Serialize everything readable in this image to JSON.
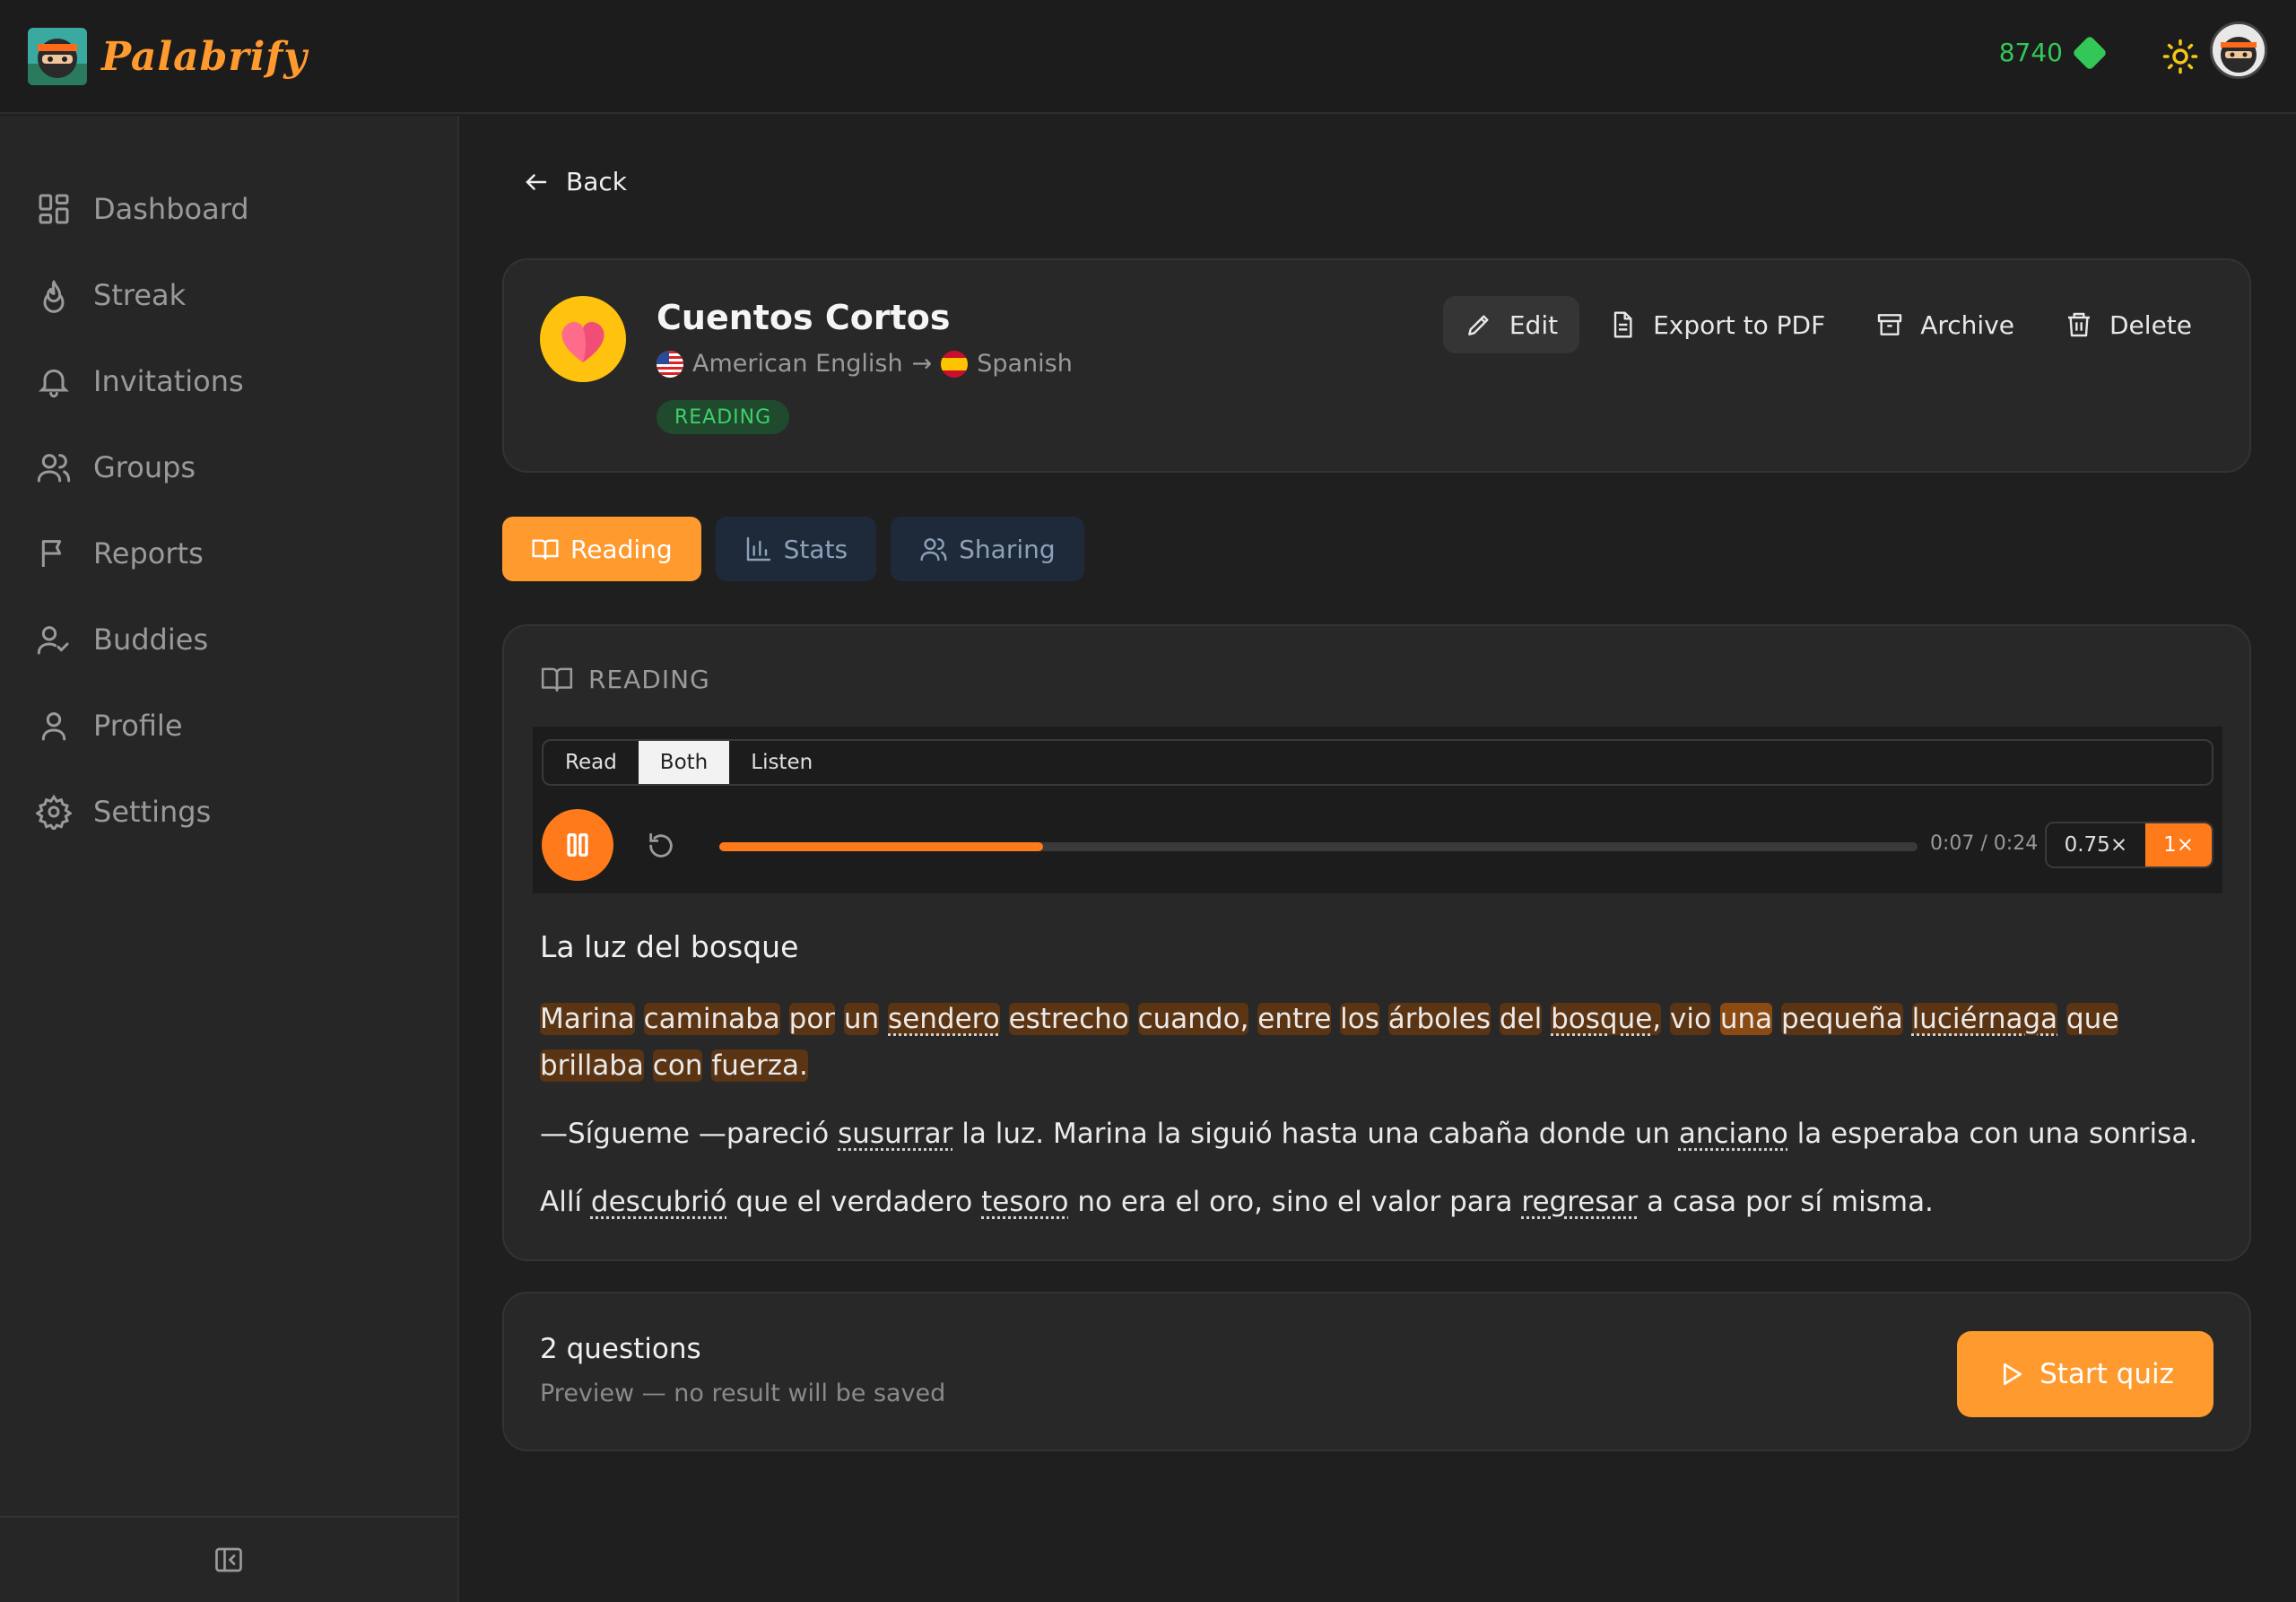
{
  "app": {
    "name": "Palabrify"
  },
  "topbar": {
    "points": "8740"
  },
  "sidebar": {
    "items": [
      {
        "label": "Dashboard",
        "icon": "dashboard-icon"
      },
      {
        "label": "Streak",
        "icon": "flame-icon"
      },
      {
        "label": "Invitations",
        "icon": "bell-icon"
      },
      {
        "label": "Groups",
        "icon": "users-icon"
      },
      {
        "label": "Reports",
        "icon": "flag-icon"
      },
      {
        "label": "Buddies",
        "icon": "user-check-icon"
      },
      {
        "label": "Profile",
        "icon": "user-icon"
      },
      {
        "label": "Settings",
        "icon": "gear-icon"
      }
    ]
  },
  "back_label": "Back",
  "deck": {
    "title": "Cuentos Cortos",
    "source_lang": "American English",
    "target_lang": "Spanish",
    "status": "READING",
    "actions": {
      "edit": "Edit",
      "export": "Export to PDF",
      "archive": "Archive",
      "delete": "Delete"
    }
  },
  "tabs": [
    {
      "label": "Reading",
      "active": true
    },
    {
      "label": "Stats",
      "active": false
    },
    {
      "label": "Sharing",
      "active": false
    }
  ],
  "reading": {
    "section_title": "READING",
    "modes": [
      "Read",
      "Both",
      "Listen"
    ],
    "active_mode": "Both",
    "time": "0:07 / 0:24",
    "progress": 0.27,
    "speeds": [
      "0.75×",
      "1×"
    ],
    "active_speed": "1×",
    "story_title": "La luz del bosque",
    "paragraphs": [
      "Marina caminaba por un sendero estrecho cuando, entre los árboles del bosque, vio una pequeña luciérnaga que brillaba con fuerza.",
      "—Sígueme —pareció susurrar la luz. Marina la siguió hasta una cabaña donde un anciano la esperaba con una sonrisa.",
      "Allí descubrió que el verdadero tesoro no era el oro, sino el valor para regresar a casa por sí misma."
    ]
  },
  "quiz": {
    "count": "2 questions",
    "note": "Preview — no result will be saved",
    "start": "Start quiz"
  },
  "colors": {
    "accent": "#ff9a2e",
    "points": "#33c758",
    "status": "#3fcf6a"
  }
}
